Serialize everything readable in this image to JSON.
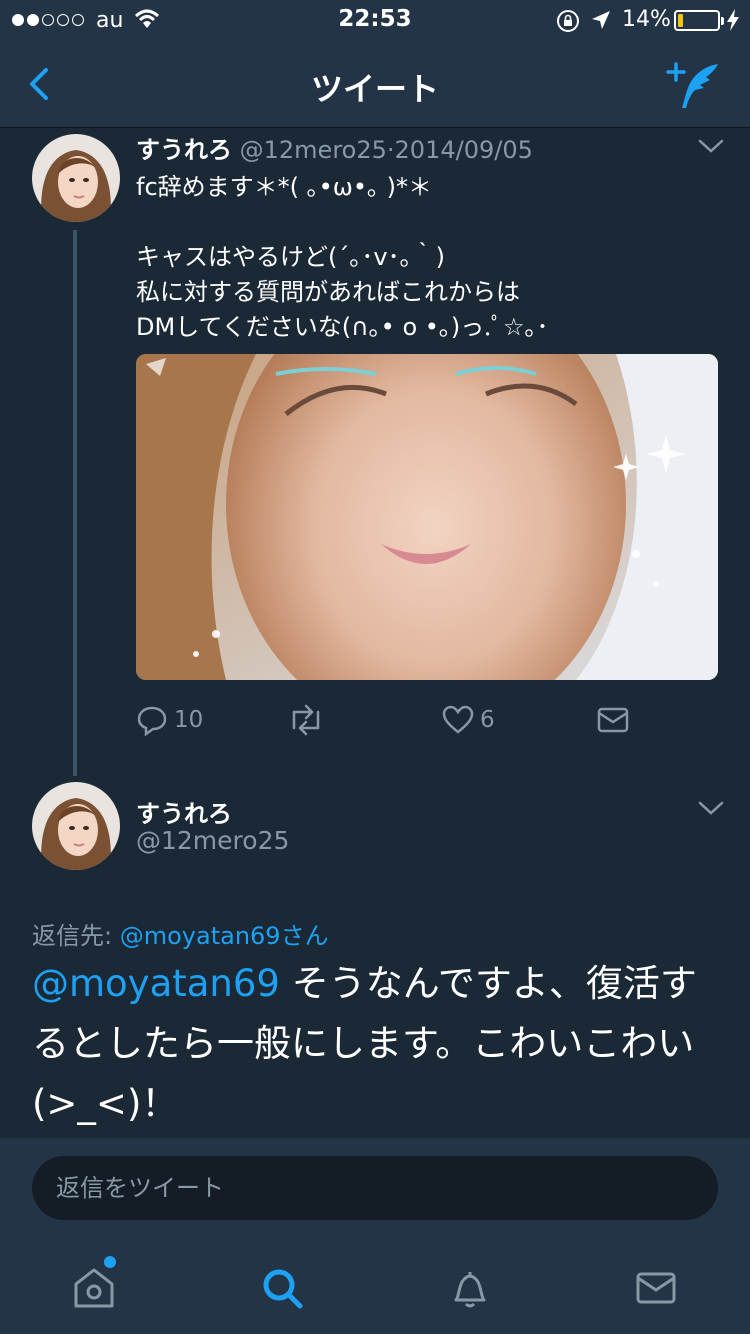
{
  "status_bar": {
    "carrier": "au",
    "time": "22:53",
    "battery_percent": "14%",
    "battery_level": 0.14,
    "signal_bars": 2
  },
  "nav": {
    "title": "ツイート",
    "back_icon": "chevron-left-icon",
    "compose_icon": "compose-tweet-icon"
  },
  "tweet": {
    "display_name": "すうれろ",
    "handle": "@12mero25",
    "separator": "·",
    "date": "2014/09/05",
    "text": "fc辞めます＊*( ｡•ω•｡ )*＊\n\nキャスはやるけど(´｡･v･｡｀)\n私に対する質問があればこれからは\nDMしてくださいな(∩｡• o •｡)っ.ﾟ☆｡･",
    "reply_count": "10",
    "like_count": "6"
  },
  "reply": {
    "display_name": "すうれろ",
    "handle": "@12mero25",
    "reply_to_label": "返信先:",
    "reply_to_user": "@moyatan69さん",
    "mention": "@moyatan69",
    "text": " そうなんですよ、復活するとしたら一般にします。こわいこわい(>_<)！"
  },
  "composer": {
    "placeholder": "返信をツイート"
  },
  "tab_bar": {
    "tabs": [
      "home-icon",
      "search-icon",
      "notifications-icon",
      "messages-icon"
    ],
    "active": "search-icon"
  },
  "colors": {
    "background": "#1b2836",
    "bar": "#243447",
    "accent": "#1da1f2",
    "secondary_text": "#8899a6"
  }
}
